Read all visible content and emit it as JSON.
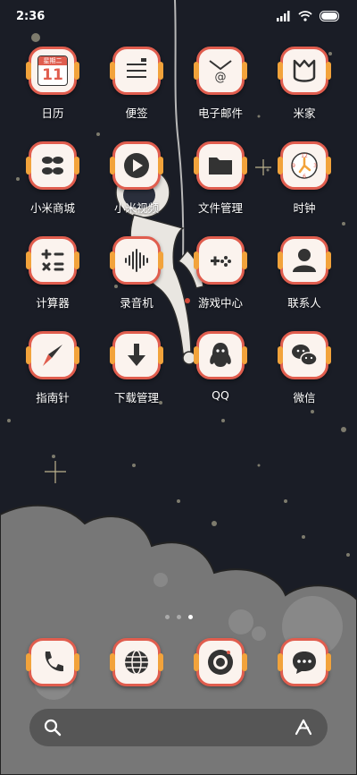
{
  "status_bar": {
    "time": "2:36"
  },
  "calendar_widget": {
    "weekday": "星期二",
    "day": "11"
  },
  "apps": [
    {
      "label": "日历",
      "icon": "calendar-icon"
    },
    {
      "label": "便签",
      "icon": "notes-icon"
    },
    {
      "label": "电子邮件",
      "icon": "email-icon"
    },
    {
      "label": "米家",
      "icon": "mijia-icon"
    },
    {
      "label": "小米商城",
      "icon": "mi-store-icon"
    },
    {
      "label": "小米视频",
      "icon": "video-play-icon"
    },
    {
      "label": "文件管理",
      "icon": "folder-icon"
    },
    {
      "label": "时钟",
      "icon": "clock-icon"
    },
    {
      "label": "计算器",
      "icon": "calculator-icon"
    },
    {
      "label": "录音机",
      "icon": "sound-wave-icon"
    },
    {
      "label": "游戏中心",
      "icon": "gamepad-icon"
    },
    {
      "label": "联系人",
      "icon": "contact-person-icon"
    },
    {
      "label": "指南针",
      "icon": "compass-icon"
    },
    {
      "label": "下载管理",
      "icon": "download-arrow-icon"
    },
    {
      "label": "QQ",
      "icon": "qq-penguin-icon"
    },
    {
      "label": "微信",
      "icon": "wechat-icon"
    }
  ],
  "dock": [
    {
      "icon": "phone-icon"
    },
    {
      "icon": "browser-globe-icon"
    },
    {
      "icon": "camera-icon"
    },
    {
      "icon": "messages-icon"
    }
  ],
  "page_indicator": {
    "count": 3,
    "active": 3
  },
  "colors": {
    "tile_border": "#e05d4e",
    "tile_tab": "#f2a33b",
    "tile_bg": "#fbf3ee"
  }
}
